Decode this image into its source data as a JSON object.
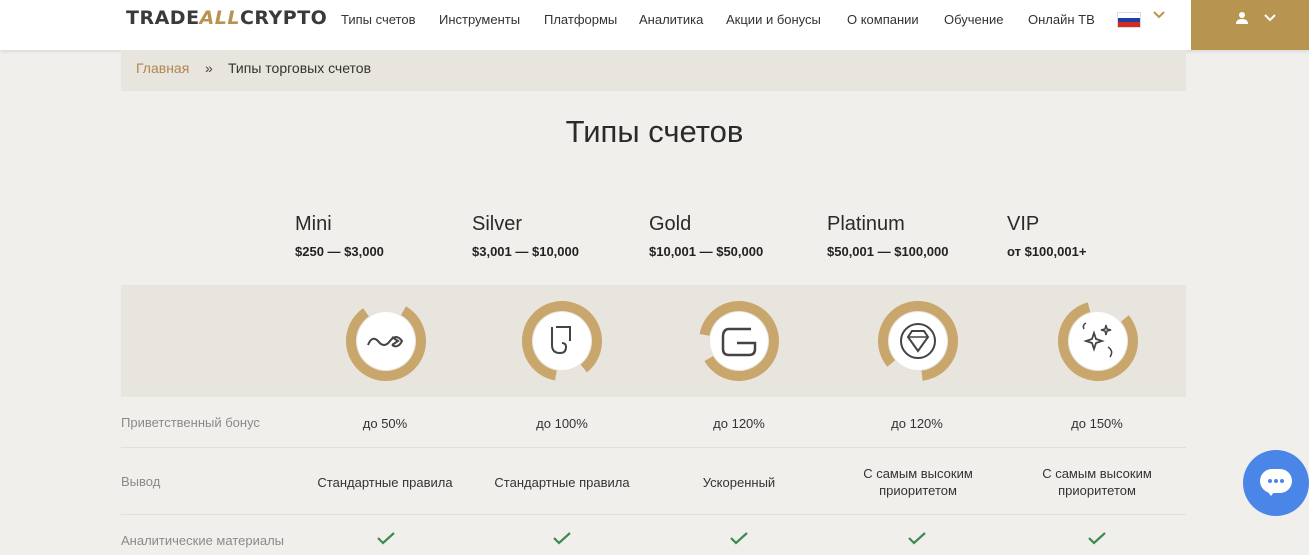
{
  "header": {
    "logo": {
      "left": "TRADE",
      "mid": "ALL",
      "right": "CRYPTO"
    },
    "nav": [
      "Типы счетов",
      "Инструменты",
      "Платформы",
      "Аналитика",
      "Акции и бонусы",
      "О компании",
      "Обучение",
      "Онлайн ТВ"
    ],
    "language": "ru-flag",
    "user_icon": "user-icon",
    "accent_color": "#b89451"
  },
  "breadcrumb": {
    "home": "Главная",
    "separator": "»",
    "current": "Типы торговых счетов"
  },
  "page_title": "Типы счетов",
  "plans": [
    {
      "name": "Mini",
      "range": "$250 — $3,000",
      "icon": "infinity-arrow-icon",
      "bonus": "до 50%",
      "withdraw": "Стандартные правила",
      "analytics": true
    },
    {
      "name": "Silver",
      "range": "$3,001 — $10,000",
      "icon": "silver-loop-icon",
      "bonus": "до 100%",
      "withdraw": "Стандартные правила",
      "analytics": true
    },
    {
      "name": "Gold",
      "range": "$10,001 — $50,000",
      "icon": "gold-coin-icon",
      "bonus": "до 120%",
      "withdraw": "Ускоренный",
      "analytics": true
    },
    {
      "name": "Platinum",
      "range": "$50,001 — $100,000",
      "icon": "diamond-icon",
      "bonus": "до 120%",
      "withdraw": "С самым высоким приоритетом",
      "analytics": true
    },
    {
      "name": "VIP",
      "range": "от $100,001+",
      "icon": "sparkle-icon",
      "bonus": "до 150%",
      "withdraw": "С самым высоким приоритетом",
      "analytics": true
    }
  ],
  "rows": {
    "bonus_label": "Приветственный бонус",
    "withdraw_label": "Вывод",
    "analytics_label": "Аналитические материалы"
  },
  "chat": {
    "icon": "chat-icon",
    "color": "#4a86e8"
  },
  "check_color": "#3d8a50"
}
